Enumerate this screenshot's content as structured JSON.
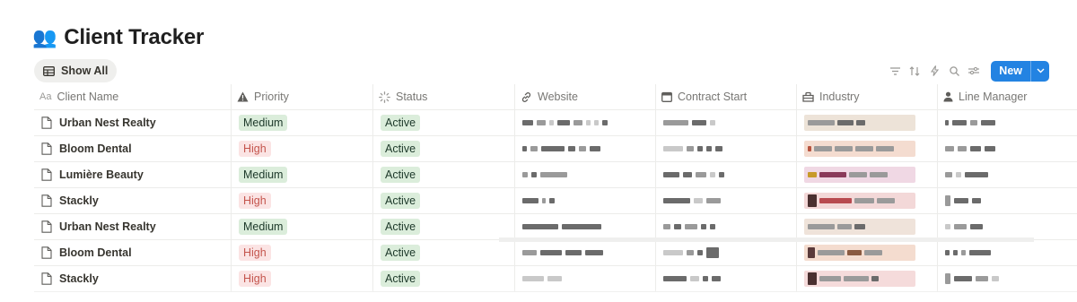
{
  "page": {
    "title": "Client Tracker",
    "title_emoji": "👥"
  },
  "view": {
    "tab_label": "Show All"
  },
  "toolbar": {
    "new_label": "New",
    "icons": [
      "filter-icon",
      "sort-icon",
      "automation-icon",
      "search-icon",
      "settings-icon"
    ]
  },
  "columns": [
    {
      "label": "Client Name",
      "icon": "text-aa-icon"
    },
    {
      "label": "Priority",
      "icon": "warning-icon"
    },
    {
      "label": "Status",
      "icon": "status-icon"
    },
    {
      "label": "Website",
      "icon": "link-icon"
    },
    {
      "label": "Contract Start",
      "icon": "calendar-icon"
    },
    {
      "label": "Industry",
      "icon": "bank-icon"
    },
    {
      "label": "Line Manager",
      "icon": "person-icon"
    }
  ],
  "rows": [
    {
      "name": "Urban Nest Realty",
      "priority": "Medium",
      "status": "Active"
    },
    {
      "name": "Bloom Dental",
      "priority": "High",
      "status": "Active"
    },
    {
      "name": "Lumière Beauty",
      "priority": "Medium",
      "status": "Active"
    },
    {
      "name": "Stackly",
      "priority": "High",
      "status": "Active"
    },
    {
      "name": "Urban Nest Realty",
      "priority": "Medium",
      "status": "Active"
    },
    {
      "name": "Bloom Dental",
      "priority": "High",
      "status": "Active"
    },
    {
      "name": "Stackly",
      "priority": "High",
      "status": "Active"
    }
  ],
  "colors": {
    "accent": "#2383e2",
    "medium_bg": "#dbeddb",
    "high_bg": "#fbe4e4",
    "high_fg": "#c4554d",
    "industry_bg": "#f4dcd0"
  }
}
